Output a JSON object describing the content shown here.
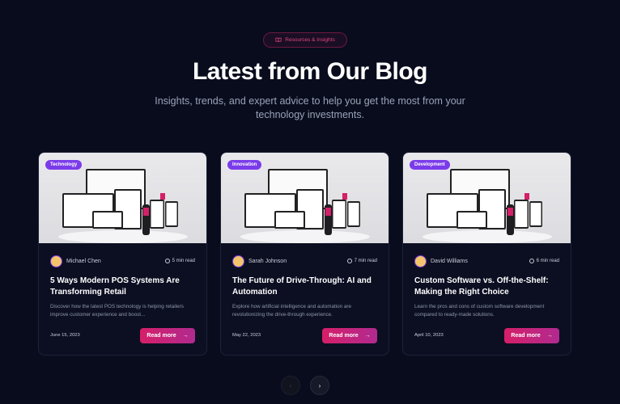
{
  "header": {
    "badge_label": "Resources & Insights",
    "badge_icon": "book-open-icon",
    "title": "Latest from Our Blog",
    "subtitle": "Insights, trends, and expert advice to help you get the most from your technology investments."
  },
  "posts": [
    {
      "tag": "Technology",
      "author": "Michael Chen",
      "read_time": "5 min read",
      "title": "5 Ways Modern POS Systems Are Transforming Retail",
      "excerpt": "Discover how the latest POS technology is helping retailers improve customer experience and boost...",
      "date": "June 15, 2023",
      "cta": "Read more"
    },
    {
      "tag": "Innovation",
      "author": "Sarah Johnson",
      "read_time": "7 min read",
      "title": "The Future of Drive-Through: AI and Automation",
      "excerpt": "Explore how artificial intelligence and automation are revolutionizing the drive-through experience.",
      "date": "May 22, 2023",
      "cta": "Read more"
    },
    {
      "tag": "Development",
      "author": "David Williams",
      "read_time": "6 min read",
      "title": "Custom Software vs. Off-the-Shelf: Making the Right Choice",
      "excerpt": "Learn the pros and cons of custom software development compared to ready-made solutions.",
      "date": "April 10, 2023",
      "cta": "Read more"
    }
  ],
  "pagination": {
    "prev_icon": "chevron-left-icon",
    "next_icon": "chevron-right-icon"
  },
  "colors": {
    "background": "#090c1d",
    "accent_pink": "#d61f69",
    "tag_purple": "#7b3bea"
  }
}
